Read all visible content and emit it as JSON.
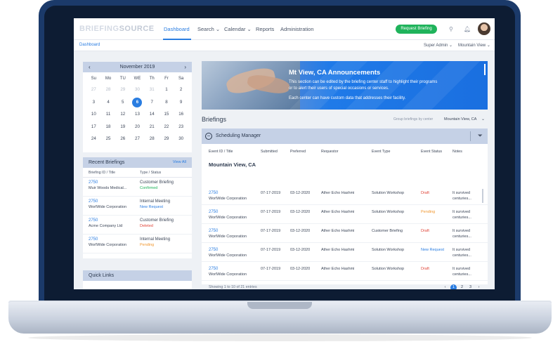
{
  "nav": {
    "logo_a": "BRIEFING",
    "logo_b": "SOURCE",
    "items": [
      "Dashboard",
      "Search",
      "Calendar",
      "Reports",
      "Administration"
    ],
    "request_button": "Request Briefing"
  },
  "subheader": {
    "breadcrumb": "Dashboard",
    "user": "Super Admin",
    "location": "Mountain View"
  },
  "calendar": {
    "month": "November 2019",
    "prev": "‹",
    "next": "›",
    "day_names": [
      "Su",
      "Mo",
      "TU",
      "WE",
      "Th",
      "Fr",
      "Sa"
    ],
    "rows": [
      [
        "27",
        "28",
        "29",
        "30",
        "31",
        "1",
        "2"
      ],
      [
        "3",
        "4",
        "5",
        "6",
        "7",
        "8",
        "9"
      ],
      [
        "10",
        "11",
        "12",
        "13",
        "14",
        "15",
        "16"
      ],
      [
        "17",
        "18",
        "19",
        "20",
        "21",
        "22",
        "23"
      ],
      [
        "24",
        "25",
        "26",
        "27",
        "28",
        "29",
        "30"
      ]
    ],
    "selected": "6",
    "today": "19"
  },
  "recent": {
    "title": "Recent Briefings",
    "view_all": "View All",
    "col1": "Briefing ID / Title",
    "col2": "Type / Status",
    "items": [
      {
        "id": "2750",
        "company": "Muir Woods Medical...",
        "type": "Customer Briefing",
        "status": "Confirmed",
        "color": "#1fb35b"
      },
      {
        "id": "2750",
        "company": "WorlWide Corporation",
        "type": "Internal Meeting",
        "status": "New Request",
        "color": "#2a7de1"
      },
      {
        "id": "2750",
        "company": "Acme Company Ltd",
        "type": "Customer Briefing",
        "status": "Deleted",
        "color": "#e0463a"
      },
      {
        "id": "2750",
        "company": "WorlWide Corporation",
        "type": "Internal Meeting",
        "status": "Pending",
        "color": "#f0962e"
      }
    ]
  },
  "quick_links": "Quick Links",
  "banner": {
    "title": "Mt View, CA Announcements",
    "line1": "This section can be edited by the briefing center staff to highlight their programs",
    "line2": "or to alert their users of special occasions or services.",
    "line3": "Each center can have custom data that addresses their facility."
  },
  "briefings": {
    "title": "Briefings",
    "group_label": "Group briefings by center",
    "group_value": "Mountain View, CA",
    "section": "Scheduling Manager",
    "headers": [
      "Event ID / Title",
      "Submitted",
      "Preferred",
      "Requestor",
      "Event Type",
      "Event Status",
      "Notes"
    ],
    "location": "Mountain View, CA",
    "rows": [
      {
        "id": "2750",
        "company": "WorlWide Corporation",
        "submitted": "07-17-2019",
        "preferred": "03-12-2020",
        "requestor": "Ather Echo Hashmi",
        "type": "Solution Workshop",
        "status": "Draft",
        "color": "#e0463a",
        "note1": "It survived",
        "note2": "centuries..."
      },
      {
        "id": "2750",
        "company": "WorlWide Corporation",
        "submitted": "07-17-2019",
        "preferred": "03-12-2020",
        "requestor": "Ather Echo Hashmi",
        "type": "Solution Workshop",
        "status": "Pending",
        "color": "#f0962e",
        "note1": "It survived",
        "note2": "centuries..."
      },
      {
        "id": "2750",
        "company": "WorlWide Corporation",
        "submitted": "07-17-2019",
        "preferred": "03-12-2020",
        "requestor": "Ather Echo Hashmi",
        "type": "Customer Briefing",
        "status": "Draft",
        "color": "#e0463a",
        "note1": "It survived",
        "note2": "centuries..."
      },
      {
        "id": "2750",
        "company": "WorlWide Corporation",
        "submitted": "07-17-2019",
        "preferred": "03-12-2020",
        "requestor": "Ather Echo Hashmi",
        "type": "Solution Workshop",
        "status": "New Request",
        "color": "#2a7de1",
        "note1": "It survived",
        "note2": "centuries..."
      },
      {
        "id": "2750",
        "company": "WorlWide Corporation",
        "submitted": "07-17-2019",
        "preferred": "03-12-2020",
        "requestor": "Ather Echo Hashmi",
        "type": "Solution Workshop",
        "status": "Draft",
        "color": "#e0463a",
        "note1": "It survived",
        "note2": "centuries..."
      }
    ],
    "showing": "Showing 1 to 10 of 21 entries",
    "pages": [
      "‹",
      "1",
      "2",
      "3",
      "›"
    ]
  }
}
